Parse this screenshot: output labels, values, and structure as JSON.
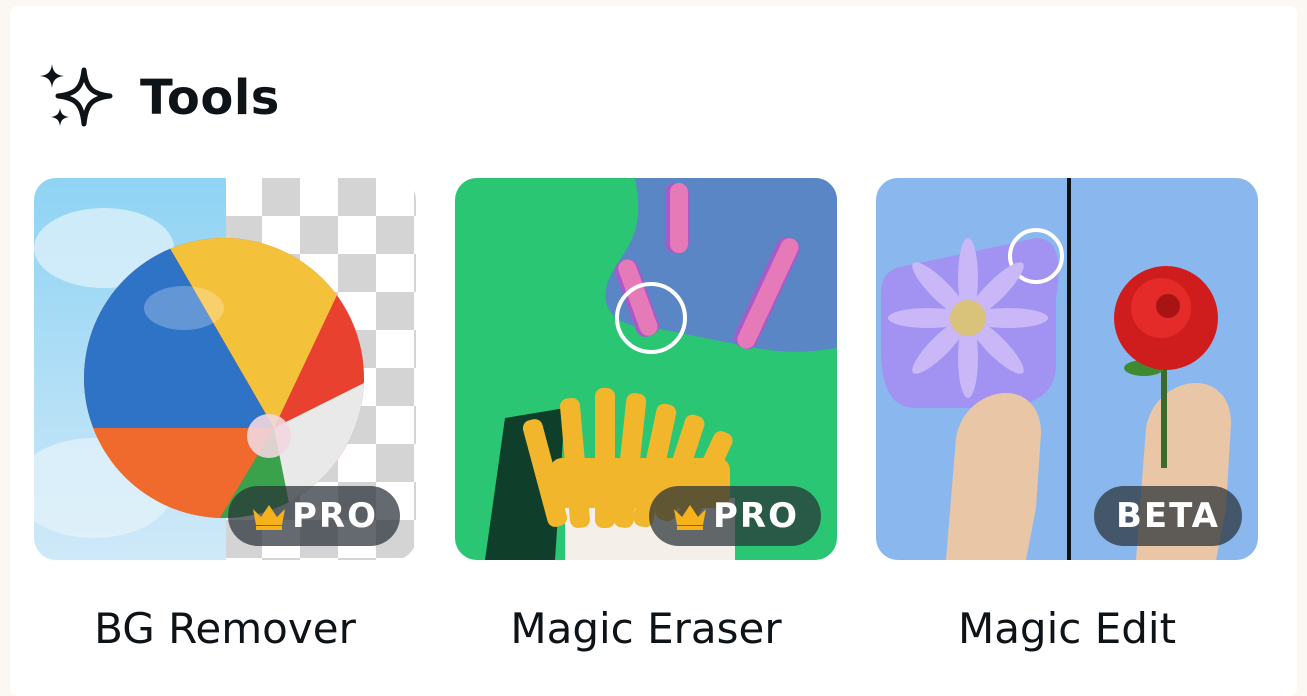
{
  "section": {
    "title": "Tools",
    "icon": "sparkles-icon"
  },
  "tools": [
    {
      "label": "BG Remover",
      "badge": "PRO",
      "badge_icon": "crown-icon"
    },
    {
      "label": "Magic Eraser",
      "badge": "PRO",
      "badge_icon": "crown-icon"
    },
    {
      "label": "Magic Edit",
      "badge": "BETA"
    }
  ],
  "colors": {
    "crown": "#f5b21a",
    "eraser_bg": "#2bc673",
    "edit_bg": "#8ab8ee"
  }
}
